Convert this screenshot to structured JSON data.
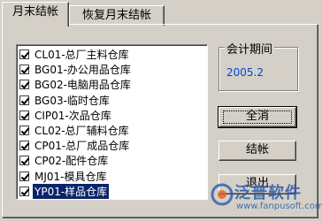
{
  "tabs": [
    {
      "label": "月末结帐"
    },
    {
      "label": "恢复月末结帐"
    }
  ],
  "warehouses": [
    {
      "label": "CL01-总厂主料仓库",
      "checked": true
    },
    {
      "label": "BG01-办公用品仓库",
      "checked": true
    },
    {
      "label": "BG02-电脑用品仓库",
      "checked": true
    },
    {
      "label": "BG03-临时仓库",
      "checked": true
    },
    {
      "label": "CIP01-次品仓库",
      "checked": true
    },
    {
      "label": "CL02-总厂辅料仓库",
      "checked": true
    },
    {
      "label": "CP01-总厂成品仓库",
      "checked": true
    },
    {
      "label": "CP02-配件仓库",
      "checked": true
    },
    {
      "label": "MJ01-模具仓库",
      "checked": true
    },
    {
      "label": "YP01-样品仓库",
      "checked": true,
      "selected": true
    }
  ],
  "period": {
    "title": "会计期间",
    "value": "2005.2"
  },
  "buttons": {
    "deselect_all": "全消",
    "close_month": "结帐",
    "exit": "退出"
  },
  "watermark": {
    "brand": "泛普软件",
    "url": "www.fanpusoft.com"
  },
  "colors": {
    "window": "#d4d0c8",
    "selection": "#0a246a",
    "period_value": "#0046d5"
  }
}
